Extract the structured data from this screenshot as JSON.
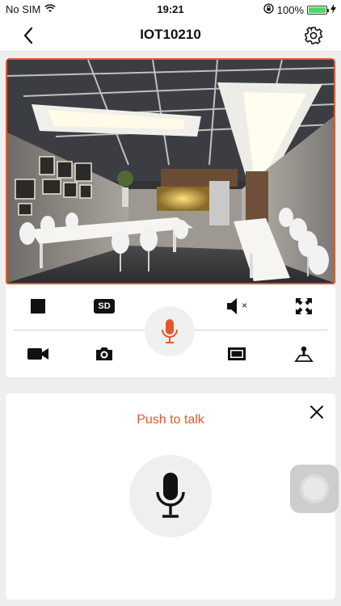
{
  "status_bar": {
    "carrier": "No SIM",
    "time": "19:21",
    "battery_percent_label": "100%",
    "battery_level": 1.0
  },
  "nav": {
    "title": "IOT10210"
  },
  "controls": {
    "row1": [
      "stop-icon",
      "sd-icon",
      "speaker-mute-icon",
      "fullscreen-icon"
    ],
    "row2": [
      "record-video-icon",
      "camera-icon",
      "screen-icon",
      "ptz-icon"
    ],
    "sd_label": "SD",
    "mute_mark": "×"
  },
  "talk": {
    "label": "Push to talk"
  },
  "colors": {
    "accent": "#e4572e",
    "icon": "#111111"
  }
}
